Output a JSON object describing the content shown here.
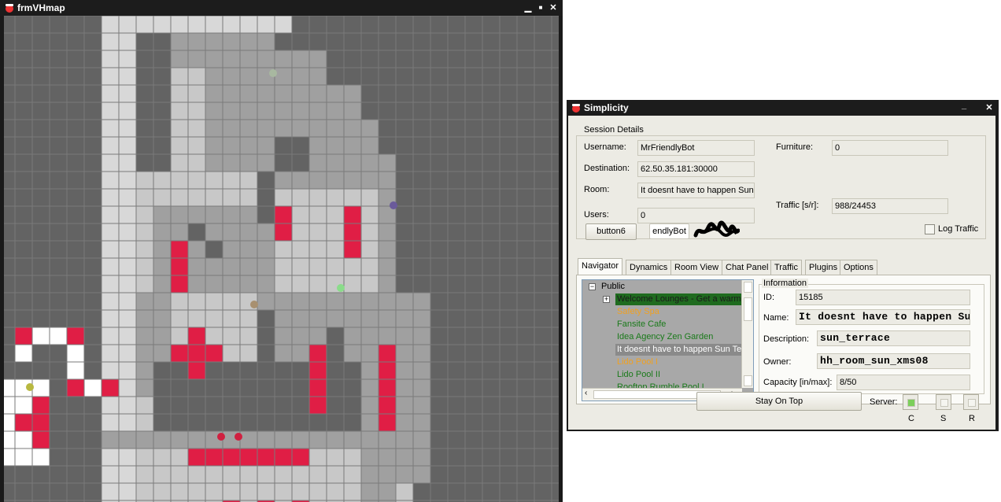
{
  "map_window": {
    "title": "frmVHmap",
    "controls": {
      "minimize": "▁",
      "maximize": "■",
      "close": "✕"
    },
    "colors": {
      "frame": "#1a1a1a",
      "wall": "#636363",
      "floor": "#c8c8c8",
      "floor_light": "#d8d8d8",
      "floor_dark": "#a0a0a0",
      "red": "#e01e45",
      "white": "#ffffff",
      "gridline": "#7a7a7a"
    }
  },
  "app_window": {
    "title": "Simplicity",
    "controls": {
      "minimize": "_",
      "close": "✕"
    },
    "session": {
      "legend": "Session Details",
      "username_label": "Username:",
      "username": "MrFriendlyBot",
      "destination_label": "Destination:",
      "destination": "62.50.35.181:30000",
      "room_label": "Room:",
      "room": "It doesnt have to happen Sun",
      "users_label": "Users:",
      "users": "0",
      "furniture_label": "Furniture:",
      "furniture": "0",
      "traffic_label": "Traffic [s/r]:",
      "traffic": "988/24453",
      "log_traffic_label": "Log Traffic",
      "button6_label": "button6",
      "bot_label": "endlyBot"
    },
    "tabs": [
      "Navigator",
      "Dynamics",
      "Room View",
      "Chat Panel",
      "Traffic",
      "Plugins",
      "Options"
    ],
    "navigator": {
      "root_label": "Public",
      "items": [
        {
          "label": "Welcome Lounges - Get a warm w",
          "color": "#1a1a1a",
          "bg": "#1f6b1f",
          "expander": "+"
        },
        {
          "label": "Safety Spa",
          "color": "#f0a020"
        },
        {
          "label": "Fansite Cafe",
          "color": "#1a7a1a"
        },
        {
          "label": "Idea Agency Zen Garden",
          "color": "#1a7a1a"
        },
        {
          "label": "It doesnt have to happen Sun Te",
          "color": "#ffffff",
          "bg": "#8a8a8a"
        },
        {
          "label": "Lido Pool I",
          "color": "#f0a020"
        },
        {
          "label": "Lido Pool II",
          "color": "#1a7a1a"
        },
        {
          "label": "Rooftop Rumble Pool I",
          "color": "#1a7a1a"
        }
      ]
    },
    "information": {
      "legend": "Information",
      "id_label": "ID:",
      "id": "15185",
      "name_label": "Name:",
      "name": "It doesnt have to happen Su",
      "description_label": "Description:",
      "description": "sun_terrace",
      "owner_label": "Owner:",
      "owner": "hh_room_sun_xms08",
      "capacity_label": "Capacity [in/max]:",
      "capacity": "8/50"
    },
    "stay_on_top_label": "Stay On Top",
    "server": {
      "label": "Server:",
      "c_label": "C",
      "s_label": "S",
      "r_label": "R",
      "c_active_color": "#7ccf5a"
    }
  }
}
